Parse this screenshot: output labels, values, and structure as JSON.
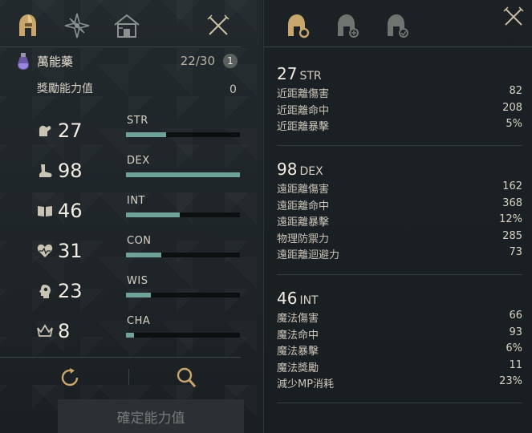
{
  "tabs": {
    "left": [
      "character-stats-tab-icon",
      "compass-star-tab-icon",
      "house-tab-icon"
    ],
    "right": [
      "helmet-gear-tab-icon",
      "helmet-plus-tab-icon",
      "helmet-check-tab-icon"
    ]
  },
  "potion": {
    "name": "萬能藥",
    "count": "22/30",
    "info": "1"
  },
  "reward": {
    "label": "獎勵能力值",
    "value": "0"
  },
  "stats": [
    {
      "abbr": "STR",
      "value": "27",
      "fill": 0.35,
      "icon": "arm-icon"
    },
    {
      "abbr": "DEX",
      "value": "98",
      "fill": 1.0,
      "icon": "boot-icon"
    },
    {
      "abbr": "INT",
      "value": "46",
      "fill": 0.47,
      "icon": "book-icon"
    },
    {
      "abbr": "CON",
      "value": "31",
      "fill": 0.31,
      "icon": "heart-icon"
    },
    {
      "abbr": "WIS",
      "value": "23",
      "fill": 0.22,
      "icon": "head-icon"
    },
    {
      "abbr": "CHA",
      "value": "8",
      "fill": 0.07,
      "icon": "crown-icon"
    }
  ],
  "actions": {
    "reset_icon": "refresh-icon",
    "search_icon": "magnifier-icon"
  },
  "confirm_label": "確定能力值",
  "details": [
    {
      "value": "27",
      "abbr": "STR",
      "rows": [
        {
          "label": "近距離傷害",
          "value": "82"
        },
        {
          "label": "近距離命中",
          "value": "208"
        },
        {
          "label": "近距離暴擊",
          "value": "5%"
        }
      ]
    },
    {
      "value": "98",
      "abbr": "DEX",
      "rows": [
        {
          "label": "遠距離傷害",
          "value": "162"
        },
        {
          "label": "遠距離命中",
          "value": "368"
        },
        {
          "label": "遠距離暴擊",
          "value": "12%"
        },
        {
          "label": "物理防禦力",
          "value": "285"
        },
        {
          "label": "遠距離迴避力",
          "value": "73"
        }
      ]
    },
    {
      "value": "46",
      "abbr": "INT",
      "rows": [
        {
          "label": "魔法傷害",
          "value": "66"
        },
        {
          "label": "魔法命中",
          "value": "93"
        },
        {
          "label": "魔法暴擊",
          "value": "6%"
        },
        {
          "label": "魔法獎勵",
          "value": "11"
        },
        {
          "label": "減少MP消耗",
          "value": "23%"
        }
      ]
    }
  ],
  "colors": {
    "bar_fill": "#6fa39a",
    "bar_track": "#0c0f10",
    "gold_icon": "#c9a66b"
  }
}
